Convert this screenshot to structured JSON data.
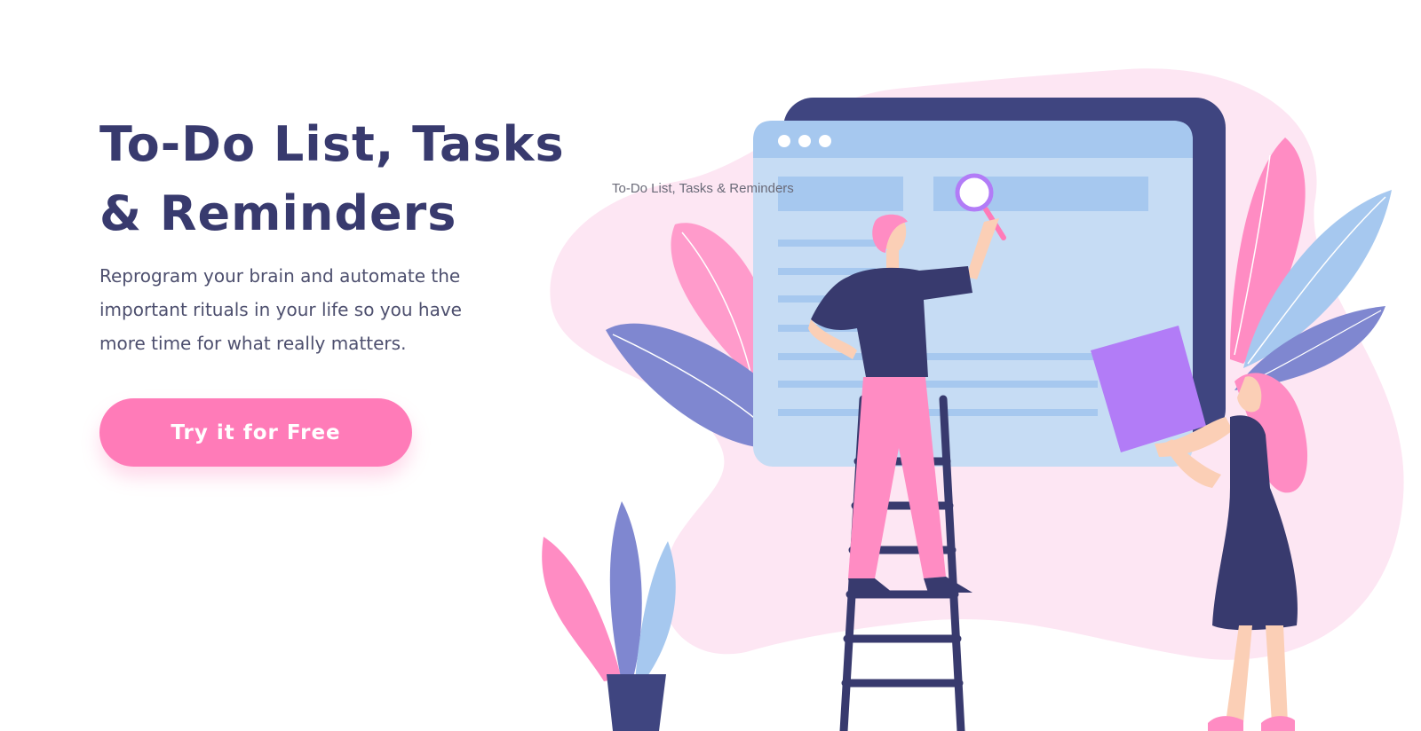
{
  "hero": {
    "title_line1": "To-Do List, Tasks",
    "title_line2": "& Reminders",
    "subtitle_line1": "Reprogram your brain and automate the",
    "subtitle_line2": "important rituals in your life so you have",
    "subtitle_line3": "more time for what really matters.",
    "cta_label": "Try it for Free"
  },
  "illustration": {
    "image_alt": "To-Do List, Tasks & Reminders"
  },
  "colors": {
    "title": "#383a6e",
    "body_text": "#4d4f6e",
    "accent_pink": "#ff7bb8",
    "navy": "#3f4580",
    "light_blue": "#c6dcf4",
    "blob_pink": "#fde6f3",
    "purple": "#b27cf7"
  }
}
